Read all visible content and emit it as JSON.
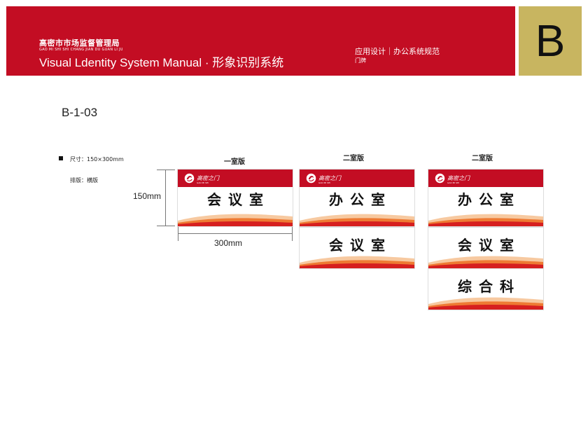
{
  "header": {
    "org_name": "高密市市场监督管理局",
    "org_pinyin": "GAO MI SHI SHI CHANG JIAN DU GUAN LI JU",
    "manual_title": "Visual Ldentity System Manual · 形象识别系统",
    "section_title": "应用设计｜办公系统规范",
    "section_sub": "门牌",
    "section_letter": "B"
  },
  "page_code": "B-1-03",
  "specs": {
    "size": "尺寸：150×300mm",
    "layout": "排版：横版"
  },
  "dimensions": {
    "height": "150mm",
    "width": "300mm"
  },
  "versions": [
    {
      "label": "一室版",
      "rooms": [
        "会议室"
      ]
    },
    {
      "label": "二室版",
      "rooms": [
        "办公室",
        "会议室"
      ]
    },
    {
      "label": "二室版",
      "rooms": [
        "办公室",
        "会议室",
        "综合科"
      ]
    }
  ],
  "sign_logo": {
    "text": "高密之门",
    "sub": "GAO MI SHI"
  },
  "colors": {
    "brand_red": "#c30d23",
    "gold": "#c8b560"
  }
}
